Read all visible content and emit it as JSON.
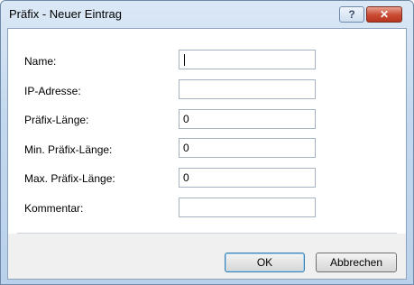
{
  "window": {
    "title": "Präfix - Neuer Eintrag",
    "help_glyph": "?",
    "close_glyph": "✕"
  },
  "form": {
    "fields": [
      {
        "label": "Name:",
        "value": ""
      },
      {
        "label": "IP-Adresse:",
        "value": ""
      },
      {
        "label": "Präfix-Länge:",
        "value": "0"
      },
      {
        "label": "Min. Präfix-Länge:",
        "value": "0"
      },
      {
        "label": "Max. Präfix-Länge:",
        "value": "0"
      },
      {
        "label": "Kommentar:",
        "value": ""
      }
    ]
  },
  "buttons": {
    "ok_label": "OK",
    "cancel_label": "Abbrechen"
  }
}
